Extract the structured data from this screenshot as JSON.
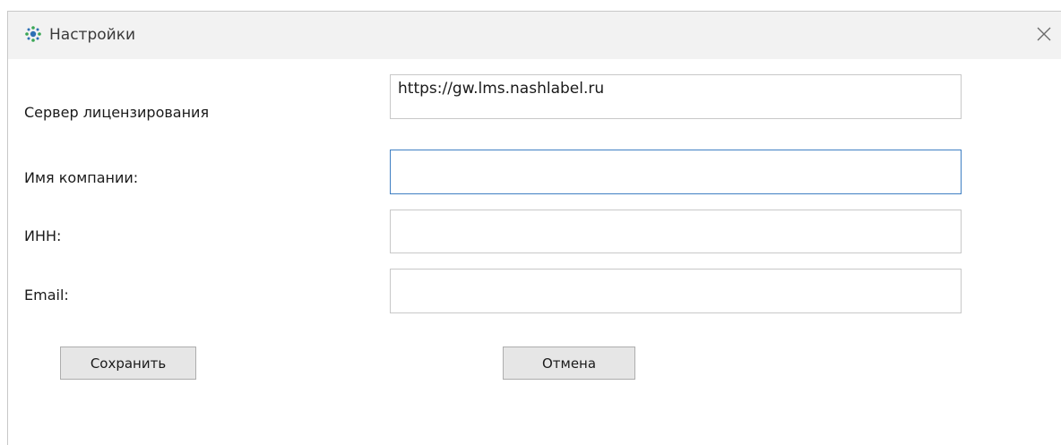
{
  "window": {
    "title": "Настройки",
    "icon": "app-settings-icon",
    "close_icon": "close-icon"
  },
  "form": {
    "server_label": "Сервер лицензирования",
    "server_value": "https://gw.lms.nashlabel.ru",
    "company_label": "Имя компании:",
    "company_value": "",
    "inn_label": "ИНН:",
    "inn_value": "",
    "email_label": "Email:",
    "email_value": ""
  },
  "buttons": {
    "save": "Сохранить",
    "cancel": "Отмена"
  },
  "colors": {
    "focus_border": "#3f7fc3",
    "titlebar": "#f2f2f2",
    "button_bg": "#e6e6e6"
  }
}
